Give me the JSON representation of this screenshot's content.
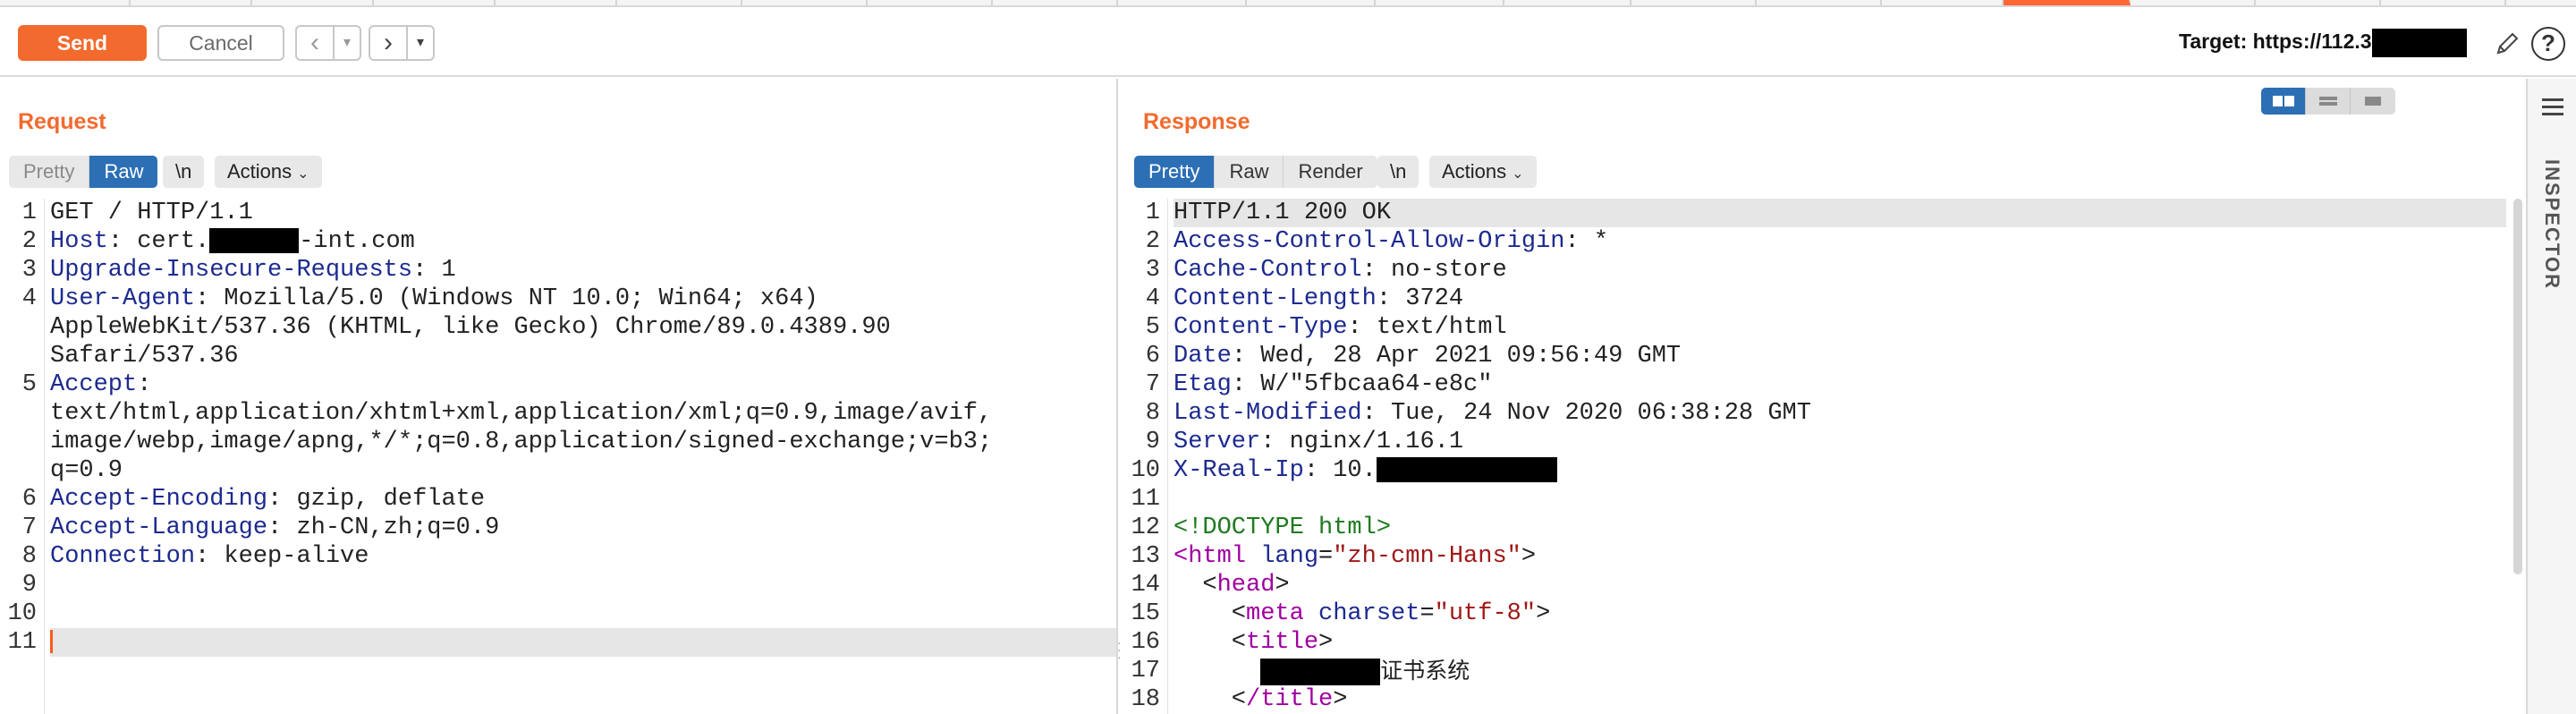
{
  "toolbar": {
    "send_label": "Send",
    "cancel_label": "Cancel",
    "back_icon": "chevron-left-icon",
    "forward_icon": "chevron-right-icon",
    "target_prefix": "Target: https://112.",
    "target_suffix": "3"
  },
  "request": {
    "title": "Request",
    "view_modes": [
      "Pretty",
      "Raw"
    ],
    "active_view": "Raw",
    "newline_label": "\\n",
    "actions_label": "Actions",
    "lines": [
      {
        "n": "1",
        "name": "",
        "value": "GET / HTTP/1.1"
      },
      {
        "n": "2",
        "name": "Host",
        "value_pre": ": cert.",
        "value_post": "-int.com"
      },
      {
        "n": "3",
        "name": "Upgrade-Insecure-Requests",
        "value": ": 1"
      },
      {
        "n": "4",
        "name": "User-Agent",
        "value": ": Mozilla/5.0 (Windows NT 10.0; Win64; x64)",
        "wrap": [
          "AppleWebKit/537.36 (KHTML, like Gecko) Chrome/89.0.4389.90",
          "Safari/537.36"
        ]
      },
      {
        "n": "5",
        "name": "Accept",
        "value": ":",
        "wrap": [
          "text/html,application/xhtml+xml,application/xml;q=0.9,image/avif,",
          "image/webp,image/apng,*/*;q=0.8,application/signed-exchange;v=b3;",
          "q=0.9"
        ]
      },
      {
        "n": "6",
        "name": "Accept-Encoding",
        "value": ": gzip, deflate"
      },
      {
        "n": "7",
        "name": "Accept-Language",
        "value": ": zh-CN,zh;q=0.9"
      },
      {
        "n": "8",
        "name": "Connection",
        "value": ": keep-alive"
      },
      {
        "n": "9"
      },
      {
        "n": "10"
      },
      {
        "n": "11"
      }
    ]
  },
  "response": {
    "title": "Response",
    "view_modes": [
      "Pretty",
      "Raw",
      "Render"
    ],
    "active_view": "Pretty",
    "newline_label": "\\n",
    "actions_label": "Actions",
    "lines": [
      {
        "n": "1",
        "text": "HTTP/1.1 200 OK"
      },
      {
        "n": "2",
        "name": "Access-Control-Allow-Origin",
        "value": ": *"
      },
      {
        "n": "3",
        "name": "Cache-Control",
        "value": ": no-store"
      },
      {
        "n": "4",
        "name": "Content-Length",
        "value": ": 3724"
      },
      {
        "n": "5",
        "name": "Content-Type",
        "value": ": text/html"
      },
      {
        "n": "6",
        "name": "Date",
        "value": ": Wed, 28 Apr 2021 09:56:49 GMT"
      },
      {
        "n": "7",
        "name": "Etag",
        "value": ": W/\"5fbcaa64-e8c\""
      },
      {
        "n": "8",
        "name": "Last-Modified",
        "value": ": Tue, 24 Nov 2020 06:38:28 GMT"
      },
      {
        "n": "9",
        "name": "Server",
        "value": ": nginx/1.16.1"
      },
      {
        "n": "10",
        "name": "X-Real-Ip",
        "value": ": 10."
      },
      {
        "n": "11"
      },
      {
        "n": "12",
        "doctype": "<!DOCTYPE html>"
      },
      {
        "n": "13",
        "tag_open": "html",
        "attr": "lang",
        "attr_val": "\"zh-cmn-Hans\""
      },
      {
        "n": "14",
        "tag": "head"
      },
      {
        "n": "15",
        "tag_open": "meta",
        "attr": "charset",
        "attr_val": "\"utf-8\""
      },
      {
        "n": "16",
        "tag": "title"
      },
      {
        "n": "17",
        "cjk": "证书系统"
      },
      {
        "n": "18",
        "tag": "/title"
      }
    ]
  },
  "inspector": {
    "label": "INSPECTOR",
    "menu_icon": "hamburger-icon"
  },
  "colors": {
    "accent": "#f26a2e",
    "selected": "#2c6fb5",
    "header_name": "#1c2a8f",
    "tag": "#a000a0",
    "attr_value": "#a01818"
  }
}
